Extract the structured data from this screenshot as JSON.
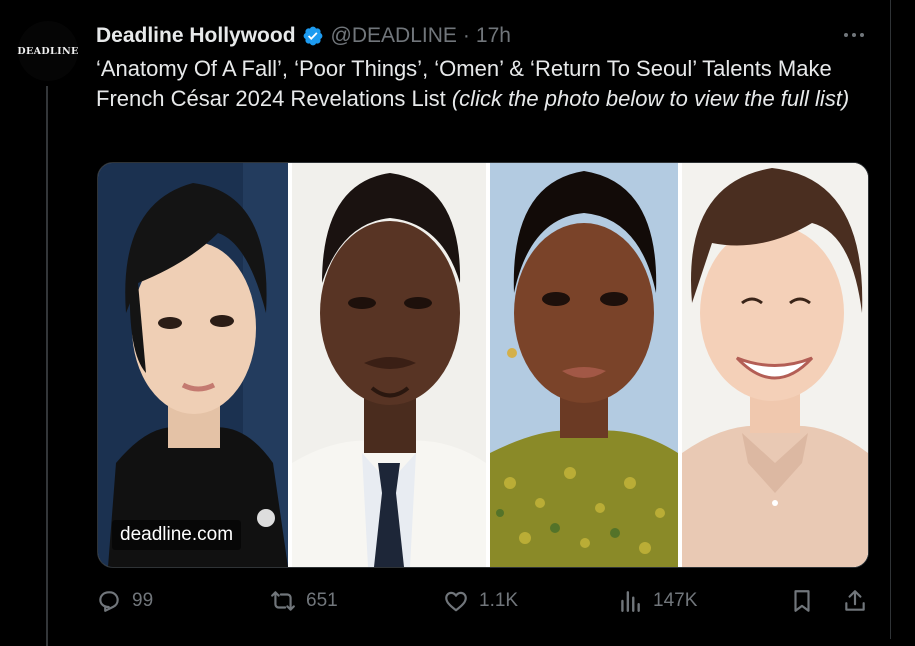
{
  "tweet": {
    "author_name": "Deadline Hollywood",
    "handle": "@DEADLINE",
    "separator": "·",
    "time": "17h",
    "avatar_text": "DEADLINE",
    "text_main": "‘Anatomy Of A Fall’, ‘Poor Things’, ‘Omen’ & ‘Return To Seoul’ Talents Make French César 2024 Revelations List",
    "text_italic": "(click the photo below to view the full list)",
    "media_watermark": "deadline.com"
  },
  "actions": {
    "replies": "99",
    "reposts": "651",
    "likes": "1.1K",
    "views": "147K"
  },
  "icons": {
    "verified": "verified-badge-icon",
    "more": "more-horizontal-icon",
    "reply": "reply-icon",
    "repost": "repost-icon",
    "like": "like-icon",
    "views": "views-icon",
    "bookmark": "bookmark-icon",
    "share": "share-icon"
  },
  "colors": {
    "background": "#000000",
    "text": "#e7e9ea",
    "secondary_text": "#71767b",
    "verified_blue": "#1d9bf0",
    "divider": "#2f3336"
  }
}
